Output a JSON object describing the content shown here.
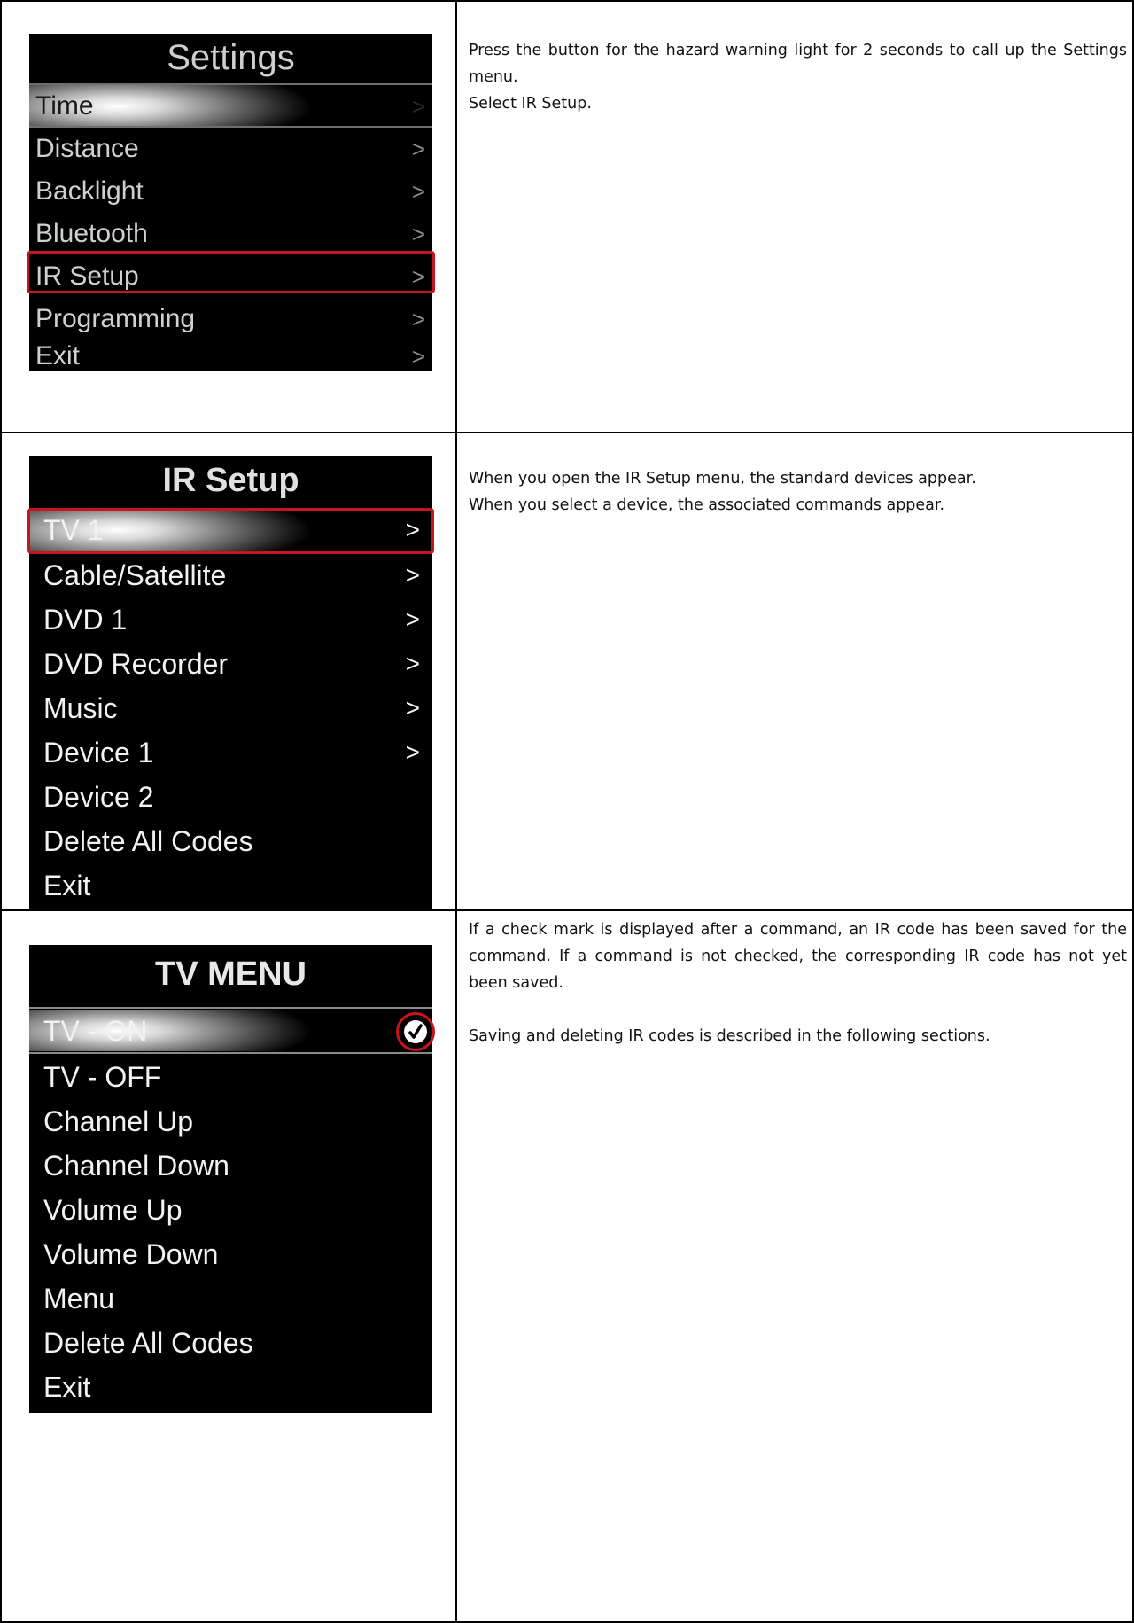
{
  "rows": [
    {
      "screen": {
        "title": "Settings",
        "items": [
          {
            "label": "Time",
            "arrow": ">"
          },
          {
            "label": "Distance",
            "arrow": ">"
          },
          {
            "label": "Backlight",
            "arrow": ">"
          },
          {
            "label": "Bluetooth",
            "arrow": ">"
          },
          {
            "label": "IR Setup",
            "arrow": ">"
          },
          {
            "label": "Programming",
            "arrow": ">"
          },
          {
            "label": "Exit",
            "arrow": ">"
          }
        ]
      },
      "description": [
        "Press the button for the hazard warning light for 2 seconds to call up the Settings menu.",
        "Select IR Setup."
      ]
    },
    {
      "screen": {
        "title": "IR Setup",
        "items": [
          {
            "label": "TV 1",
            "arrow": ">"
          },
          {
            "label": "Cable/Satellite",
            "arrow": ">"
          },
          {
            "label": "DVD 1",
            "arrow": ">"
          },
          {
            "label": "DVD Recorder",
            "arrow": ">"
          },
          {
            "label": "Music",
            "arrow": ">"
          },
          {
            "label": "Device 1",
            "arrow": ">"
          },
          {
            "label": "Device 2",
            "arrow": ""
          },
          {
            "label": "Delete All Codes",
            "arrow": ""
          },
          {
            "label": "Exit",
            "arrow": ""
          }
        ]
      },
      "description": [
        "When you open the IR Setup menu, the standard devices appear.",
        "When you select a device, the associated commands appear."
      ]
    },
    {
      "screen": {
        "title": "TV MENU",
        "items": [
          {
            "label": "TV - ON",
            "checked": true
          },
          {
            "label": "TV - OFF"
          },
          {
            "label": "Channel Up"
          },
          {
            "label": "Channel Down"
          },
          {
            "label": "Volume Up"
          },
          {
            "label": "Volume Down"
          },
          {
            "label": "Menu"
          },
          {
            "label": "Delete All Codes"
          },
          {
            "label": "Exit"
          }
        ]
      },
      "description": [
        "If a check mark is displayed after a command, an IR code has been saved for the command. If a command is not checked, the corresponding IR code has not yet been saved.",
        "Saving and deleting IR codes is described in the following sections."
      ]
    }
  ],
  "colors": {
    "highlight_box": "#c8141e",
    "screen_background": "#000000"
  },
  "icons": {
    "menu_arrow": "chevron-right-icon",
    "check": "check-icon"
  }
}
